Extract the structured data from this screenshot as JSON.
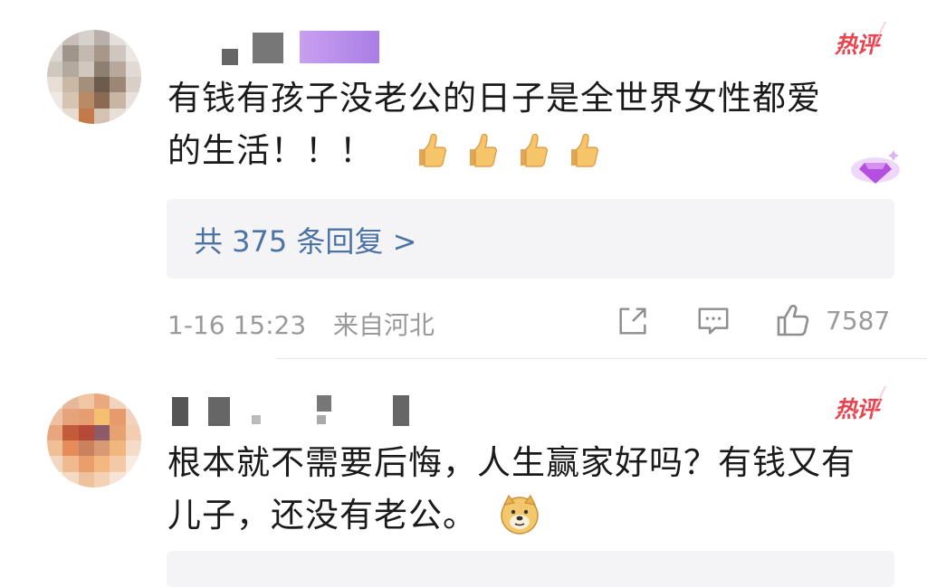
{
  "comments": [
    {
      "badge": "热评",
      "text_line1": "有钱有孩子没老公的日子是全世界女性都爱",
      "text_line2": "的生活！！！",
      "emoji": "thumbs-up x4",
      "reply_link": "共 375 条回复 >",
      "timestamp": "1-16 15:23",
      "location": "来自河北",
      "like_count": "7587"
    },
    {
      "badge": "热评",
      "text_line1": "根本就不需要后悔，人生赢家好吗？有钱又有",
      "text_line2": "儿子，还没有老公。",
      "emoji": "doge"
    }
  ],
  "colors": {
    "badge": "#e8434e",
    "link": "#4b73a3",
    "meta": "#9a9a9a",
    "reply_bg": "#f4f4f6",
    "gem_accent": "#b44fe0"
  },
  "icons": [
    "share-icon",
    "comment-icon",
    "like-icon",
    "thumbs-up-emoji",
    "doge-emoji",
    "gem-badge-icon"
  ]
}
